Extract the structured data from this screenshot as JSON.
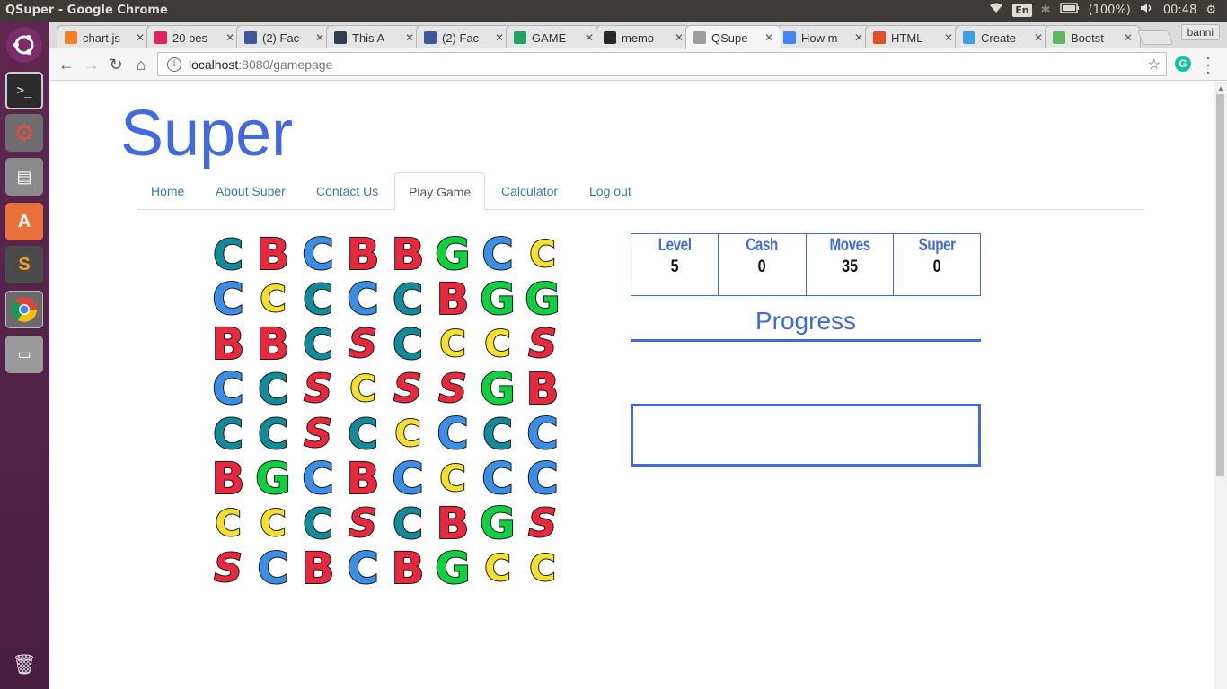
{
  "window": {
    "title": "QSuper - Google Chrome"
  },
  "tray": {
    "lang": "En",
    "battery": "(100%)",
    "time": "00:48"
  },
  "tabs": [
    {
      "label": "chart.js",
      "fav_color": "#f48024"
    },
    {
      "label": "20 bes",
      "fav_color": "#e0245e"
    },
    {
      "label": "(2) Fac",
      "fav_color": "#3b5998"
    },
    {
      "label": "This A",
      "fav_color": "#2c3e50"
    },
    {
      "label": "(2) Fac",
      "fav_color": "#3b5998"
    },
    {
      "label": "GAME",
      "fav_color": "#1fa463"
    },
    {
      "label": "memo",
      "fav_color": "#24292e"
    },
    {
      "label": "QSupe",
      "fav_color": "#9e9e9e"
    },
    {
      "label": "How m",
      "fav_color": "#4285f4"
    },
    {
      "label": "HTML",
      "fav_color": "#e44d26"
    },
    {
      "label": "Create",
      "fav_color": "#3ba0e6"
    },
    {
      "label": "Bootst",
      "fav_color": "#5cb85c"
    }
  ],
  "active_tab_index": 7,
  "user_chip": "banni",
  "address": {
    "host": "localhost",
    "path": ":8080/gamepage"
  },
  "site": {
    "brand": "Super",
    "nav": [
      "Home",
      "About Super",
      "Contact Us",
      "Play Game",
      "Calculator",
      "Log out"
    ],
    "active_nav": "Play Game"
  },
  "stats": [
    {
      "label": "Level",
      "value": "5"
    },
    {
      "label": "Cash",
      "value": "0"
    },
    {
      "label": "Moves",
      "value": "35"
    },
    {
      "label": "Super",
      "value": "0"
    }
  ],
  "progress": {
    "title": "Progress"
  },
  "board": {
    "legend": {
      "T": {
        "glyph": "C",
        "color": "#138a9a",
        "name": "teal-crescent-c"
      },
      "B": {
        "glyph": "B",
        "color": "#e8283c",
        "name": "red-b"
      },
      "C": {
        "glyph": "C",
        "color": "#3a8ee6",
        "name": "blue-c"
      },
      "G": {
        "glyph": "G",
        "color": "#10d040",
        "name": "green-g"
      },
      "Y": {
        "glyph": "C",
        "color": "#f4e02e",
        "name": "yellow-c"
      },
      "S": {
        "glyph": "S",
        "color": "#e8283c",
        "name": "red-s"
      }
    },
    "rows": [
      [
        "T",
        "B",
        "C",
        "B",
        "B",
        "G",
        "C",
        "Y"
      ],
      [
        "C",
        "Y",
        "T",
        "C",
        "T",
        "B",
        "G",
        "G"
      ],
      [
        "B",
        "B",
        "T",
        "S",
        "T",
        "Y",
        "Y",
        "S"
      ],
      [
        "C",
        "T",
        "S",
        "Y",
        "S",
        "S",
        "G",
        "B"
      ],
      [
        "T",
        "T",
        "S",
        "T",
        "Y",
        "C",
        "T",
        "C"
      ],
      [
        "B",
        "G",
        "C",
        "B",
        "C",
        "Y",
        "C",
        "C"
      ],
      [
        "Y",
        "Y",
        "T",
        "S",
        "T",
        "B",
        "G",
        "S"
      ],
      [
        "S",
        "C",
        "B",
        "C",
        "B",
        "G",
        "Y",
        "Y"
      ]
    ]
  }
}
